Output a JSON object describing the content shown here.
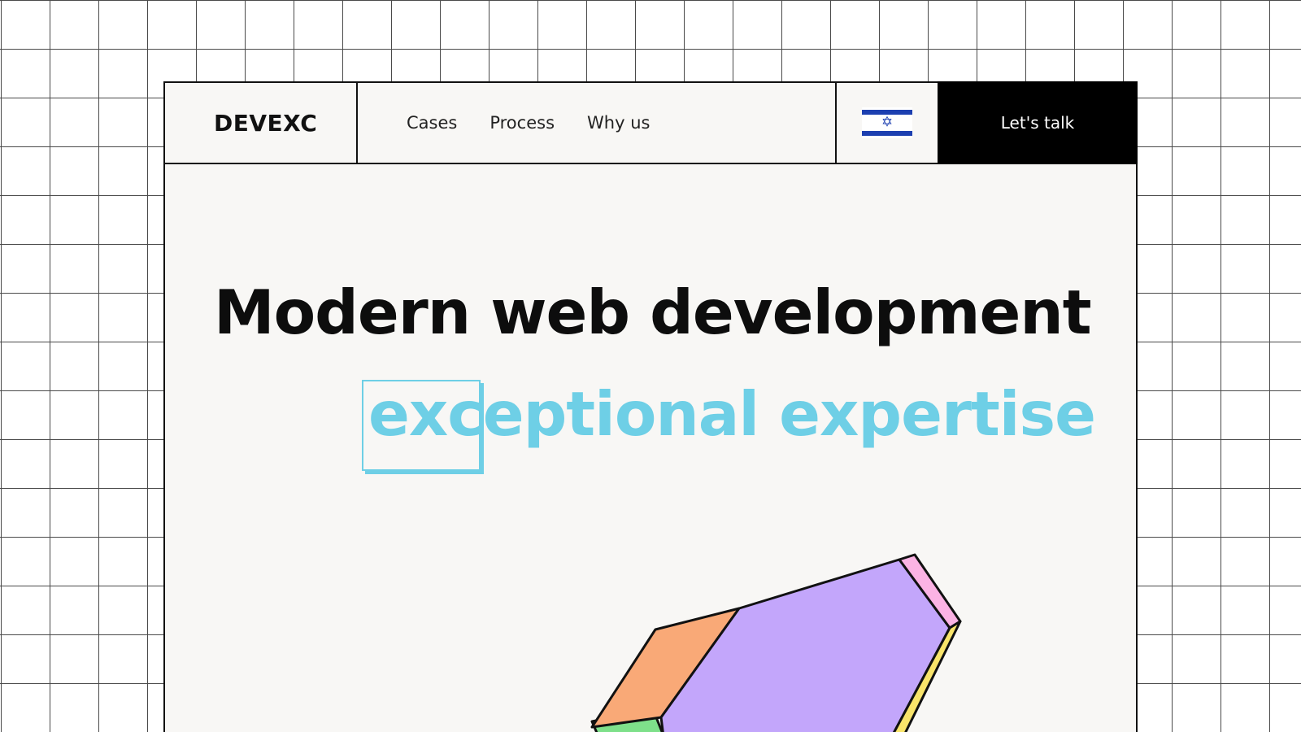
{
  "brand": {
    "name": "DEVEXC"
  },
  "nav": {
    "items": [
      {
        "label": "Cases"
      },
      {
        "label": "Process"
      },
      {
        "label": "Why us"
      }
    ]
  },
  "language": {
    "icon": "israel-flag-icon"
  },
  "cta": {
    "label": "Let's talk"
  },
  "hero": {
    "line1": "Modern web development",
    "line2": "exceptional expertise"
  },
  "colors": {
    "accent": "#6ecfe6",
    "cta_background": "#000000",
    "frame_background": "#f8f7f5",
    "shape_purple": "#c3a6fb",
    "shape_orange": "#f9a977",
    "shape_pink": "#fbb3e4",
    "shape_yellow": "#f9e46a",
    "shape_green": "#7ee08a"
  }
}
